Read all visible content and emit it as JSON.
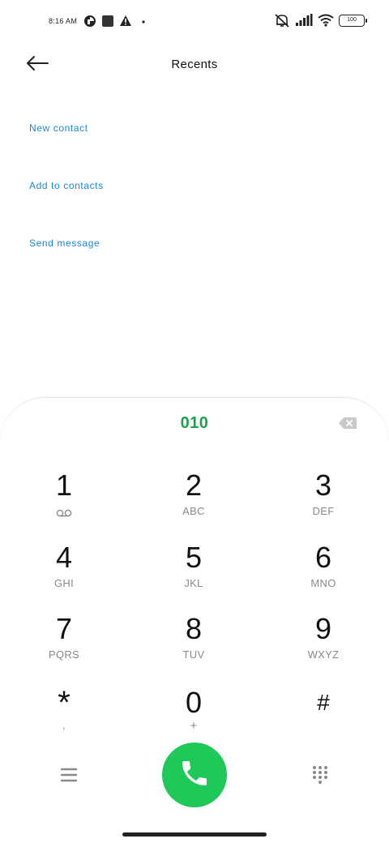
{
  "status_bar": {
    "time": "8:16 AM",
    "battery": "100",
    "left_icons": [
      "app-circle-icon",
      "square-app-icon",
      "warning-icon",
      "dot-icon"
    ],
    "right_icons": [
      "mute-icon",
      "signal-icon",
      "wifi-icon",
      "battery-icon"
    ]
  },
  "header": {
    "title": "Recents",
    "back_icon": "arrow-left-icon"
  },
  "actions": {
    "new_contact": "New contact",
    "add_to_contacts": "Add to contacts",
    "send_message": "Send message"
  },
  "dialer": {
    "number": "010",
    "backspace_icon": "backspace-icon",
    "keys": [
      {
        "digit": "1",
        "letters": ""
      },
      {
        "digit": "2",
        "letters": "ABC"
      },
      {
        "digit": "3",
        "letters": "DEF"
      },
      {
        "digit": "4",
        "letters": "GHI"
      },
      {
        "digit": "5",
        "letters": "JKL"
      },
      {
        "digit": "6",
        "letters": "MNO"
      },
      {
        "digit": "7",
        "letters": "PQRS"
      },
      {
        "digit": "8",
        "letters": "TUV"
      },
      {
        "digit": "9",
        "letters": "WXYZ"
      },
      {
        "digit": "*",
        "letters": ","
      },
      {
        "digit": "0",
        "letters": "+"
      },
      {
        "digit": "#",
        "letters": ""
      }
    ],
    "call_color": "#1ec95a",
    "number_color": "#1aa34a"
  },
  "colors": {
    "action_blue": "#1b86e0"
  }
}
